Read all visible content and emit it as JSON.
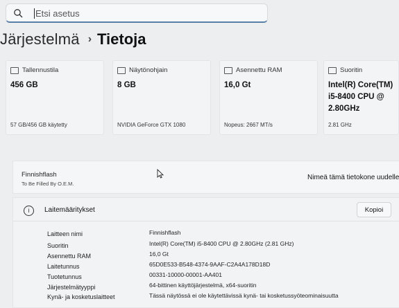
{
  "search": {
    "placeholder": "Etsi asetus"
  },
  "breadcrumb": {
    "parent": "Järjestelmä",
    "separator": "›",
    "current": "Tietoja"
  },
  "cards": [
    {
      "id": "storage",
      "label": "Tallennustila",
      "value": "456 GB",
      "detail": "57 GB/456 GB käytetty",
      "icon": "storage-icon"
    },
    {
      "id": "gpu",
      "label": "Näytönohjain",
      "value": "8 GB",
      "detail": "NVIDIA GeForce GTX 1080",
      "icon": "gpu-icon"
    },
    {
      "id": "ram",
      "label": "Asennettu RAM",
      "value": "16,0 Gt",
      "detail": "Nopeus: 2667 MT/s",
      "icon": "ram-icon"
    },
    {
      "id": "cpu",
      "label": "Suoritin",
      "value_lines": [
        "Intel(R) Core(TM)",
        "i5-8400 CPU @",
        "2.80GHz"
      ],
      "detail": "2.81 GHz",
      "icon": "cpu-icon"
    }
  ],
  "device": {
    "name": "Finnishflash",
    "oem": "To Be Filled By O.E.M.",
    "rename_button": "Nimeä tämä tietokone uudelleen"
  },
  "specs": {
    "title": "Laitemääritykset",
    "copy_button": "Kopioi",
    "rows": [
      {
        "key": "Laitteen nimi",
        "value": "Finnishflash"
      },
      {
        "key": "Suoritin",
        "value": "Intel(R) Core(TM) i5-8400 CPU @ 2.80GHz (2.81 GHz)"
      },
      {
        "key": "Asennettu RAM",
        "value": "16,0 Gt"
      },
      {
        "key": "Laitetunnus",
        "value": "65D0E533-B548-4374-9AAF-C2A4A178D18D"
      },
      {
        "key": "Tuotetunnus",
        "value": "00331-10000-00001-AA401"
      },
      {
        "key": "Järjestelmätyyppi",
        "value": "64-bittinen käyttöjärjestelmä, x64-suoritin"
      },
      {
        "key": "Kynä- ja kosketuslaitteet",
        "value": "Tässä näytössä ei ole käytettävissä kynä- tai kosketussyöteominaisuutta"
      }
    ]
  }
}
